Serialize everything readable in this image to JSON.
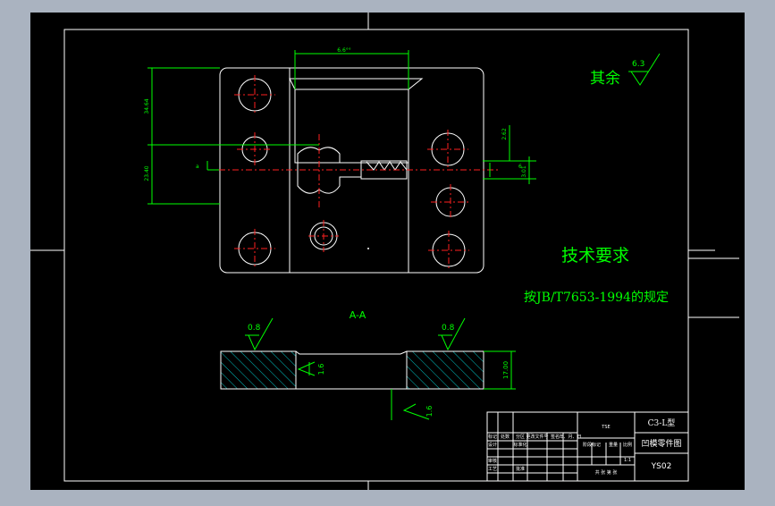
{
  "colors": {
    "background": "#aab3c0",
    "sheet": "#000000",
    "outline": "#ffffff",
    "dimension": "#00ff00",
    "centerline": "#ff2020",
    "hatch": "#00c0c0",
    "note": "#00ff00"
  },
  "plan_view": {
    "dim_top": "6.6°°",
    "dim_left_upper": "34.64",
    "dim_left_lower": "23.40",
    "dim_right_upper": "2.62",
    "dim_right_lower": "3.01",
    "dim_small_a": "a",
    "dim_small_b": "6"
  },
  "roughness_rest": {
    "label": "其余",
    "value": "6.3"
  },
  "tech_requirements": {
    "title": "技术要求",
    "note": "按JB/T7653-1994的规定"
  },
  "section_view": {
    "label": "A-A",
    "rough_left": "0.8",
    "rough_right": "0.8",
    "rough_inner_left": "1.6",
    "rough_bottom": "1.6",
    "dim_height": "17.00"
  },
  "title_block": {
    "school": "TSE",
    "code": "C3-L型",
    "drawing_name": "凹模零件图",
    "drawing_no": "YS02",
    "col_labels": [
      "标记",
      "处数",
      "分区",
      "更改文件号",
      "签名",
      "年、月、日"
    ],
    "row_labels": [
      "设计",
      "审核",
      "工艺"
    ],
    "std_label": "标准化",
    "stage_label": "阶段标记",
    "weight_label": "重量",
    "scale_label": "比例",
    "scale_value": "1:1",
    "sheet_label": "共 张 第 张",
    "approve_label": "批准"
  }
}
